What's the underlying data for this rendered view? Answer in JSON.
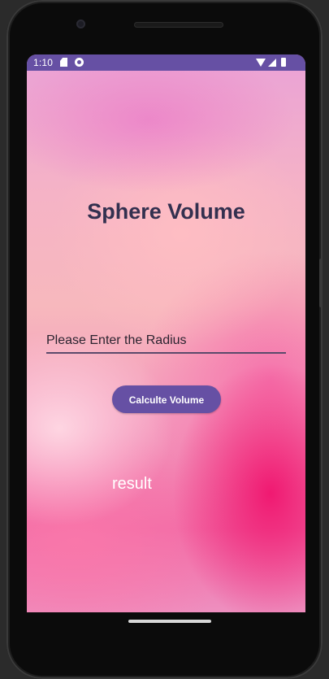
{
  "status_bar": {
    "time": "1:10",
    "icons": [
      "sd-card-icon",
      "face-icon",
      "wifi-icon",
      "signal-icon",
      "battery-icon"
    ]
  },
  "app": {
    "title": "Sphere Volume",
    "radius_input": {
      "placeholder": "Please Enter the Radius",
      "value": ""
    },
    "calculate_button_label": "Calculte Volume",
    "result_text": "result"
  },
  "colors": {
    "accent": "#6650a4",
    "title_text": "#33304f",
    "result_text": "#ffffff"
  }
}
